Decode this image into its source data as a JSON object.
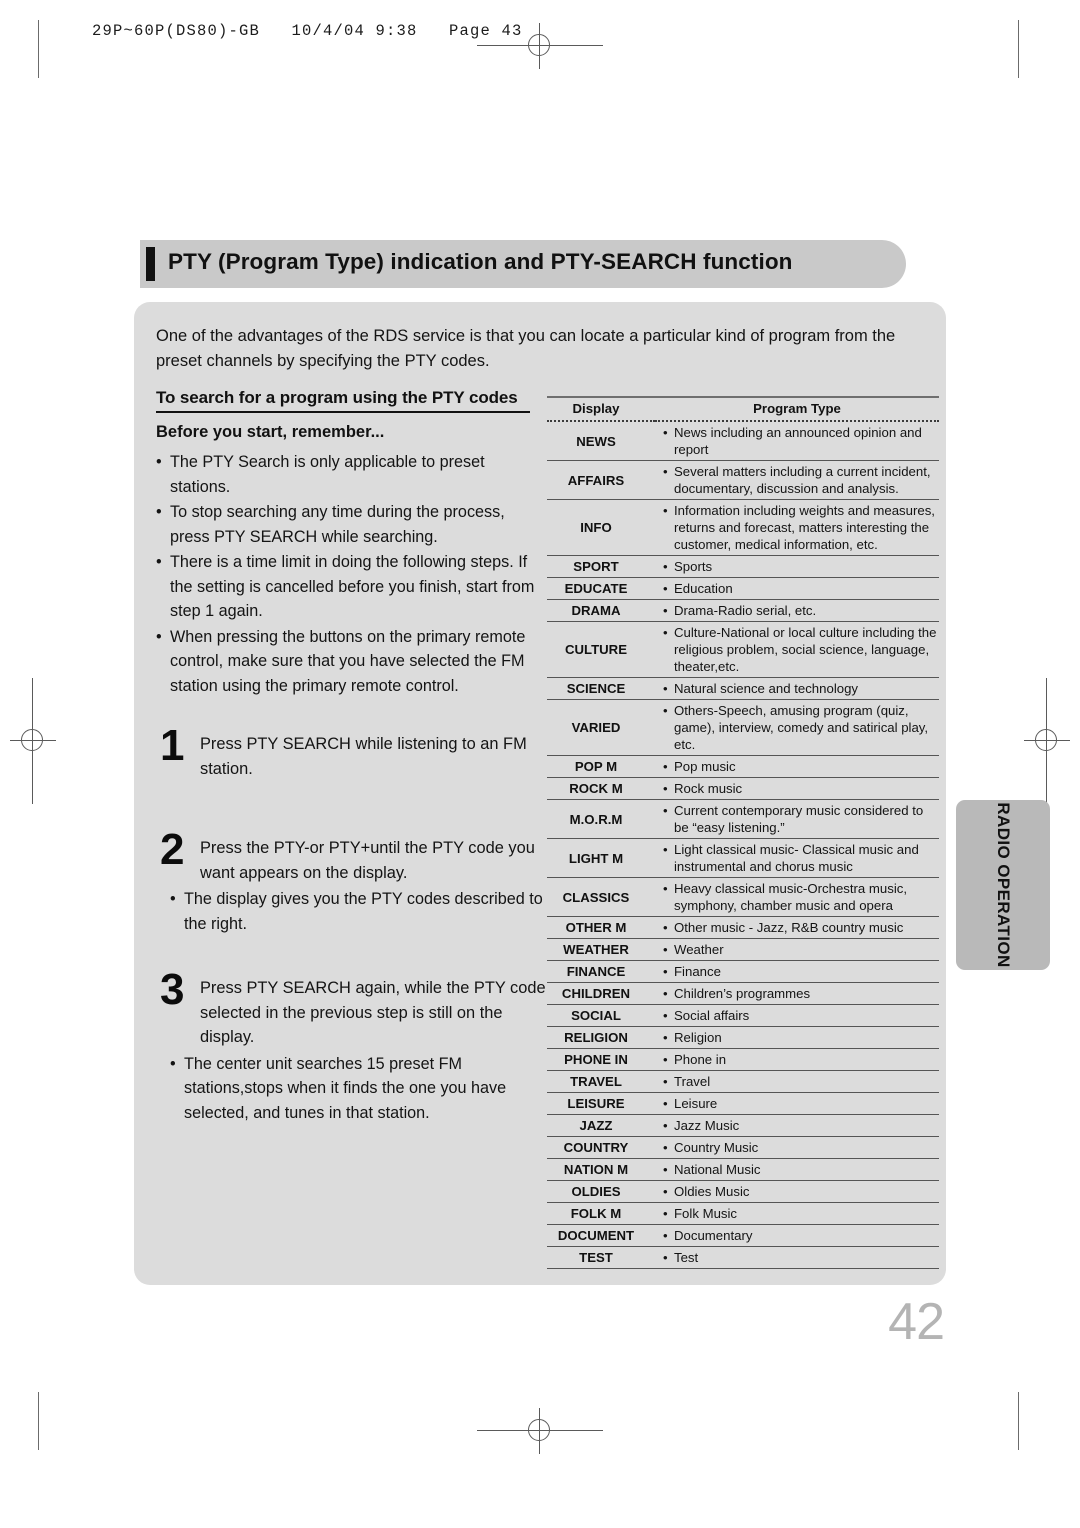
{
  "prepress": {
    "header_text": "29P~60P(DS80)-GB   10/4/04 9:38   Page 43"
  },
  "header": {
    "title": "PTY (Program Type) indication and PTY-SEARCH function"
  },
  "intro": {
    "paragraph": "One  of the advantages of the RDS service is that you can locate a particular kind of program from the preset channels by specifying the PTY codes."
  },
  "left": {
    "section_heading": "To search for a program using the PTY codes",
    "before_heading": "Before you start, remember...",
    "bullets": [
      "The PTY Search is only applicable to preset stations.",
      "To stop searching any time during the process, press PTY SEARCH while searching.",
      "There is a time limit in doing the following steps. If the setting is cancelled before you finish, start from step 1 again.",
      "When pressing the buttons on the primary remote control, make sure that you have selected the FM station using the primary remote control."
    ],
    "steps": [
      {
        "number": "1",
        "text": "Press PTY SEARCH while listening to an FM station.",
        "notes": []
      },
      {
        "number": "2",
        "text": "Press the PTY-or PTY+until the PTY code you want appears on the display.",
        "notes": [
          "The display gives you the PTY codes described to the right."
        ]
      },
      {
        "number": "3",
        "text": "Press PTY SEARCH again, while the PTY code selected in the previous step is still on the display.",
        "notes": [
          "The center unit searches 15 preset FM stations,stops when it finds the one you have selected, and tunes in that station."
        ]
      }
    ]
  },
  "table": {
    "columns": [
      "Display",
      "Program Type"
    ],
    "rows": [
      {
        "display": "NEWS",
        "type": "News including an announced opinion and report"
      },
      {
        "display": "AFFAIRS",
        "type": "Several matters including a current incident, documentary, discussion and analysis."
      },
      {
        "display": "INFO",
        "type": "Information including weights and measures, returns and forecast, matters interesting the customer, medical information, etc."
      },
      {
        "display": "SPORT",
        "type": "Sports"
      },
      {
        "display": "EDUCATE",
        "type": "Education"
      },
      {
        "display": "DRAMA",
        "type": "Drama-Radio serial, etc."
      },
      {
        "display": "CULTURE",
        "type": "Culture-National or local culture including the religious problem, social science, language, theater,etc."
      },
      {
        "display": "SCIENCE",
        "type": "Natural science and technology"
      },
      {
        "display": "VARIED",
        "type": "Others-Speech, amusing program (quiz, game), interview, comedy and satirical play, etc."
      },
      {
        "display": "POP M",
        "type": "Pop music"
      },
      {
        "display": "ROCK M",
        "type": "Rock music"
      },
      {
        "display": "M.O.R.M",
        "type": "Current contemporary music considered to be “easy listening.”"
      },
      {
        "display": "LIGHT M",
        "type": "Light classical music- Classical music and instrumental and chorus music"
      },
      {
        "display": "CLASSICS",
        "type": "Heavy classical  music-Orchestra music, symphony, chamber music and opera"
      },
      {
        "display": "OTHER M",
        "type": "Other music - Jazz, R&B country music"
      },
      {
        "display": "WEATHER",
        "type": "Weather"
      },
      {
        "display": "FINANCE",
        "type": "Finance"
      },
      {
        "display": "CHILDREN",
        "type": "Children’s programmes"
      },
      {
        "display": "SOCIAL",
        "type": "Social affairs"
      },
      {
        "display": "RELIGION",
        "type": "Religion"
      },
      {
        "display": "PHONE IN",
        "type": "Phone in"
      },
      {
        "display": "TRAVEL",
        "type": "Travel"
      },
      {
        "display": "LEISURE",
        "type": "Leisure"
      },
      {
        "display": "JAZZ",
        "type": "Jazz Music"
      },
      {
        "display": "COUNTRY",
        "type": "Country Music"
      },
      {
        "display": "NATION M",
        "type": "National Music"
      },
      {
        "display": "OLDIES",
        "type": "Oldies Music"
      },
      {
        "display": "FOLK M",
        "type": "Folk Music"
      },
      {
        "display": "DOCUMENT",
        "type": "Documentary"
      },
      {
        "display": "TEST",
        "type": "Test"
      }
    ]
  },
  "side_tab": {
    "label": "RADIO OPERATION"
  },
  "footer": {
    "page_number": "42"
  },
  "colors": {
    "panel_bg": "#dcdcdc",
    "title_bg": "#c9c9c9",
    "tab_bg": "#b9b9b9",
    "page_number": "#b4b4b4"
  }
}
